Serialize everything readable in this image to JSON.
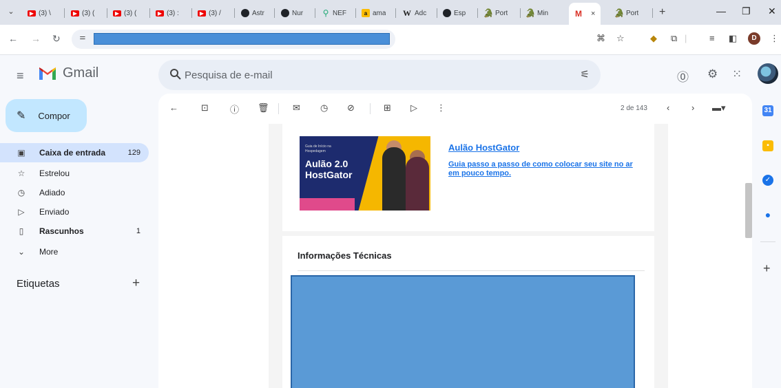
{
  "browser": {
    "tabs": [
      {
        "icon": "youtube-icon",
        "label": "(3) \\"
      },
      {
        "icon": "youtube-icon",
        "label": "(3) ("
      },
      {
        "icon": "youtube-icon",
        "label": "(3) ("
      },
      {
        "icon": "youtube-icon",
        "label": "(3) :"
      },
      {
        "icon": "youtube-icon",
        "label": "(3) /"
      },
      {
        "icon": "github-icon",
        "label": "Astr"
      },
      {
        "icon": "github-icon",
        "label": "Nur"
      },
      {
        "icon": "nep-icon",
        "label": "NEF"
      },
      {
        "icon": "amazon-icon",
        "label": "ama"
      },
      {
        "icon": "wikipedia-icon",
        "label": "Adc"
      },
      {
        "icon": "github-icon",
        "label": "Esp"
      },
      {
        "icon": "hostgator-icon",
        "label": "Port"
      },
      {
        "icon": "hostgator-icon",
        "label": "Min"
      }
    ],
    "active_tab_close": "×",
    "after_tab_label": "Port",
    "new_tab": "+",
    "profile_initial": "D"
  },
  "gmail": {
    "brand": "Gmail",
    "search_placeholder": "Pesquisa de e-mail",
    "compose_label": "Compor",
    "nav": [
      {
        "label": "Caixa de entrada",
        "count": "129",
        "icon": "inbox-icon"
      },
      {
        "label": "Estrelou",
        "count": "",
        "icon": "star-icon"
      },
      {
        "label": "Adiado",
        "count": "",
        "icon": "clock-icon"
      },
      {
        "label": "Enviado",
        "count": "",
        "icon": "send-icon"
      },
      {
        "label": "Rascunhos",
        "count": "1",
        "icon": "draft-icon"
      },
      {
        "label": "More",
        "count": "",
        "icon": "chevron-down-icon"
      }
    ],
    "labels_heading": "Etiquetas",
    "pagination": "2 de 143"
  },
  "email": {
    "banner": {
      "small_text": "Guia de Início na Hospedagem",
      "big_text": "Aulão 2.0 HostGator"
    },
    "promo_title": "Aulão HostGator",
    "promo_description": "Guia passo a passo de como colocar seu site no ar em pouco tempo.",
    "section_title": "Informações Técnicas"
  },
  "colors": {
    "compose_bg": "#c2e7ff",
    "active_nav_bg": "#d3e3fd",
    "link": "#1a73e8",
    "redaction": "#5a9ad6"
  }
}
